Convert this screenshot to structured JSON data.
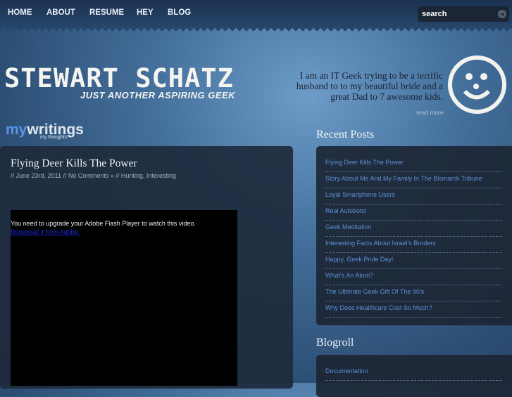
{
  "nav": {
    "items": [
      "HOME",
      "ABOUT",
      "RESUME",
      "HEY",
      "BLOG"
    ],
    "search_placeholder": "search"
  },
  "header": {
    "title": "STEWART SCHATZ",
    "tagline": "JUST ANOTHER ASPIRING GEEK",
    "intro": "I am an IT Geek trying to be a terrific husband to to my beautiful bride and a great Dad to 7 awesome kids.",
    "read_more": "read more"
  },
  "section": {
    "my": "my",
    "writings": "writings",
    "sub": "my thoughts"
  },
  "post": {
    "title": "Flying Deer Kills The Power",
    "meta": "// June 23rd, 2011 // No Comments » // Hunting, Interesting",
    "flash_msg": "You need to upgrade your Adobe Flash Player to watch this video.",
    "flash_link": "Download it from Adobe."
  },
  "sidebar": {
    "recent_title": "Recent Posts",
    "recent": [
      "Flying Deer Kills The Power",
      "Story About Me And My Family In The Bismarck Tribune",
      "Loyal Smartphone Users",
      "Real Autobots!",
      "Geek Meditation",
      "Interesting Facts About Israel's Borders",
      "Happy, Geek Pride Day!",
      "What's An Atom?",
      "The Ultimate Geek Gift Of The 90's",
      "Why Does Healthcare Cost So Much?"
    ],
    "blogroll_title": "Blogroll",
    "blogroll": [
      "Documentation"
    ]
  }
}
